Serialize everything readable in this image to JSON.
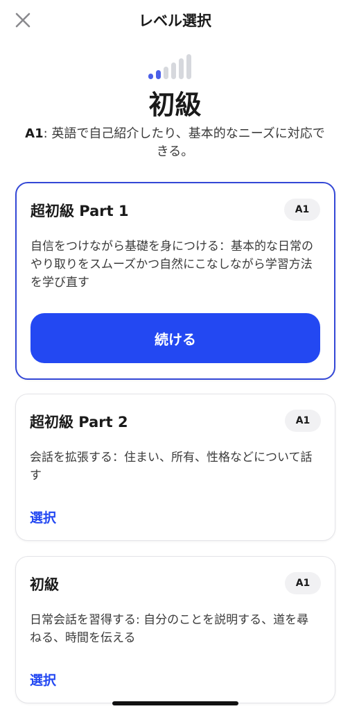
{
  "header": {
    "title": "レベル選択",
    "close_icon": "close-icon"
  },
  "level": {
    "signal_total_bars": 6,
    "signal_active_bars": 2,
    "title": "初級",
    "code": "A1",
    "description": ": 英語で自己紹介したり、基本的なニーズに対応できる。"
  },
  "courses": [
    {
      "title": "超初級 Part 1",
      "badge": "A1",
      "description": "自信をつけながら基礎を身につける：基本的な日常のやり取りをスムーズかつ自然にこなしながら学習方法を学び直す",
      "action_label": "続ける",
      "selected": true
    },
    {
      "title": "超初級 Part 2",
      "badge": "A1",
      "description": "会話を拡張する：住まい、所有、性格などについて話す",
      "action_label": "選択",
      "selected": false
    },
    {
      "title": "初級",
      "badge": "A1",
      "description": "日常会話を習得する: 自分のことを説明する、道を尋ねる、時間を伝える",
      "action_label": "選択",
      "selected": false
    }
  ],
  "colors": {
    "accent": "#2348f2",
    "selected_border": "#3347d6",
    "signal_active": "#4b5fe8",
    "signal_inactive": "#d6d8dd"
  }
}
